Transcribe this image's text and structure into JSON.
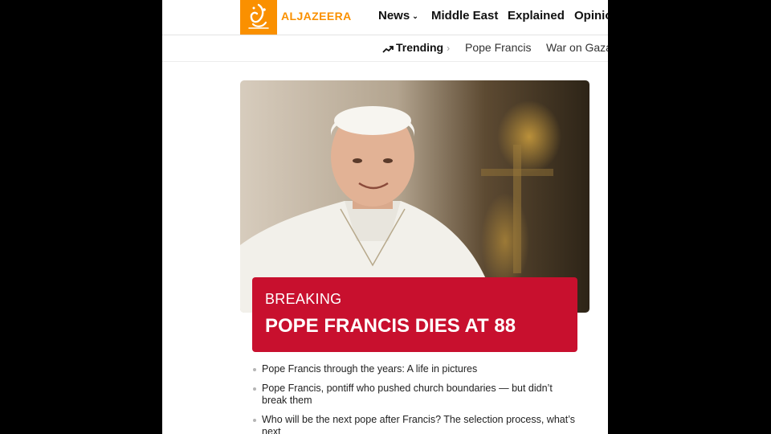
{
  "brand": {
    "name": "ALJAZEERA",
    "color": "#fa9000",
    "logo_icon": "aljazeera-calligraphy-logo"
  },
  "nav": {
    "items": [
      {
        "label": "News",
        "has_dropdown": true
      },
      {
        "label": "Middle East"
      },
      {
        "label": "Explained"
      },
      {
        "label": "Opinion"
      }
    ]
  },
  "trending": {
    "label": "Trending",
    "icon": "trending-up-icon",
    "links": [
      "Pope Francis",
      "War on Gaza"
    ]
  },
  "hero": {
    "image_subject": "Pope Francis portrait",
    "breaking_color": "#c8102e",
    "kicker": "BREAKING",
    "headline": "POPE FRANCIS DIES AT 88"
  },
  "related": [
    "Pope Francis through the years: A life in pictures",
    "Pope Francis, pontiff who pushed church boundaries — but didn’t break them",
    "Who will be the next pope after Francis? The selection process, what’s next"
  ]
}
